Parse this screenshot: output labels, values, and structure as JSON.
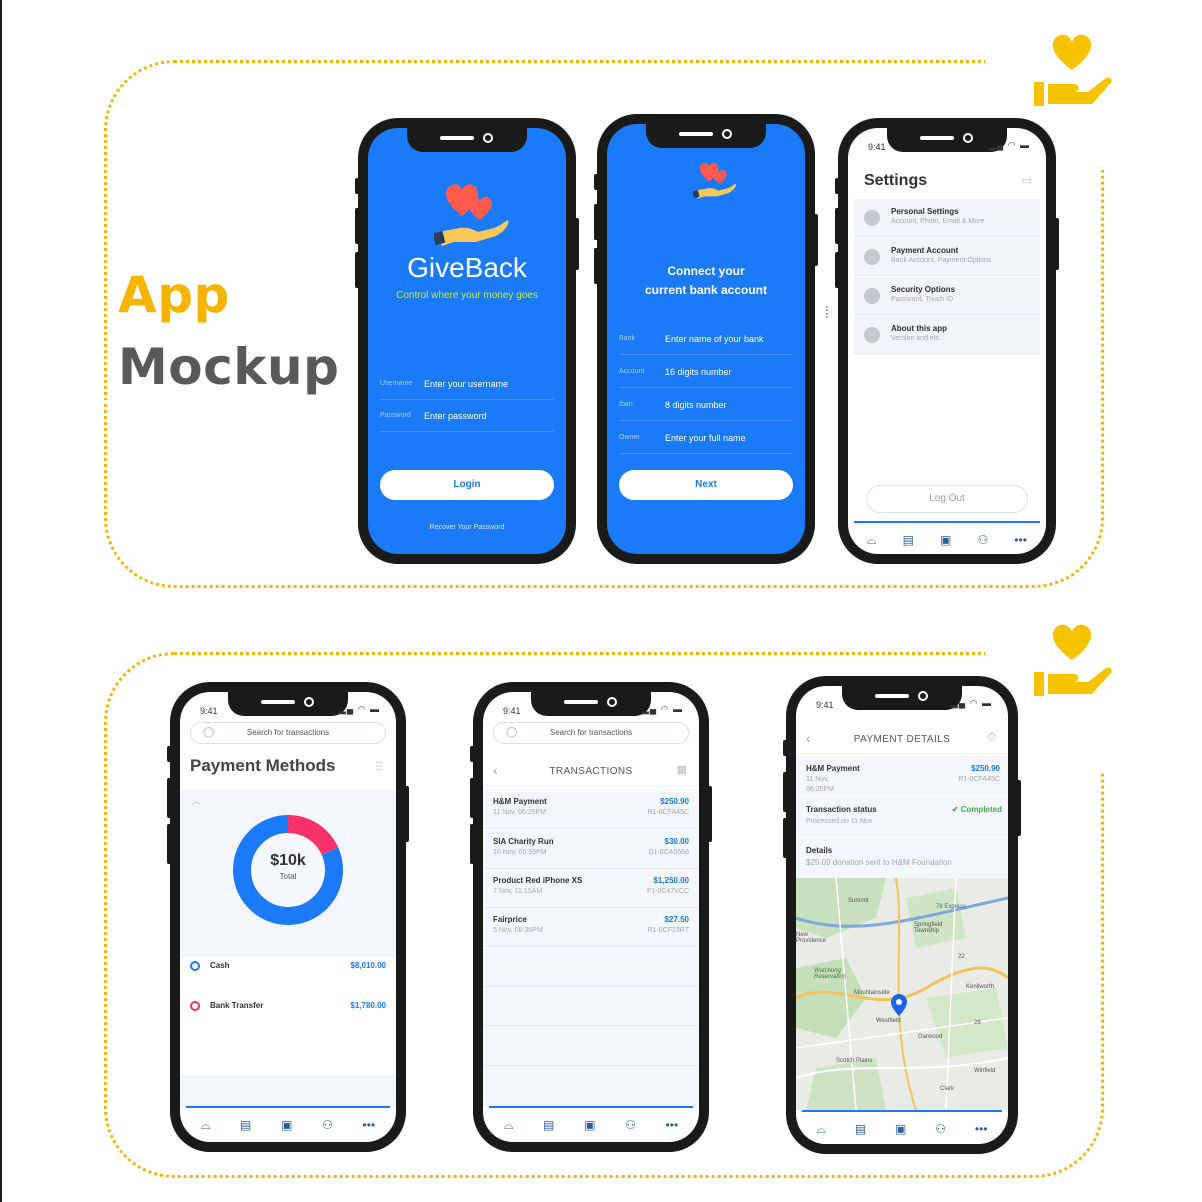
{
  "heading": {
    "line1": "App",
    "line2": "Mockup"
  },
  "colors": {
    "brand_blue": "#1b7af7",
    "accent_yellow": "#f5b400",
    "heart": "#ff5b4e",
    "success": "#3fae49"
  },
  "status_bar": {
    "time": "9:41"
  },
  "login": {
    "app_name": "GiveBack",
    "tagline": "Control where your money goes",
    "username_label": "Username",
    "username_placeholder": "Enter your username",
    "password_label": "Password",
    "password_placeholder": "Enter password",
    "login_button": "Login",
    "recover_link": "Recover Your Password"
  },
  "connect": {
    "title_line1": "Connect your",
    "title_line2": "current bank account",
    "fields": [
      {
        "label": "Bank",
        "placeholder": "Enter name of your bank"
      },
      {
        "label": "Account",
        "placeholder": "16 digits number"
      },
      {
        "label": "Iban",
        "placeholder": "8 digits number"
      },
      {
        "label": "Owner",
        "placeholder": "Enter your full name"
      }
    ],
    "next_button": "Next"
  },
  "settings": {
    "title": "Settings",
    "items": [
      {
        "title": "Personal Settings",
        "subtitle": "Account, Photo, Email & More"
      },
      {
        "title": "Payment Account",
        "subtitle": "Bank Account, Payment Options"
      },
      {
        "title": "Security Options",
        "subtitle": "Password, Touch ID"
      },
      {
        "title": "About this app",
        "subtitle": "Version and etc."
      }
    ],
    "logout_button": "Log Out"
  },
  "tabbar": {
    "icons": [
      "dashboard-icon",
      "document-icon",
      "wallet-icon",
      "users-icon",
      "more-icon"
    ]
  },
  "search": {
    "placeholder": "Search for transactions"
  },
  "payment_methods": {
    "title": "Payment Methods",
    "total_value": "$10k",
    "total_label": "Total",
    "methods": [
      {
        "name": "Cash",
        "amount": "$8,010.00",
        "color": "#1b7af7",
        "share": 0.818
      },
      {
        "name": "Bank Transfer",
        "amount": "$1,780.00",
        "color": "#f5326a",
        "share": 0.182
      }
    ]
  },
  "transactions": {
    "title": "TRANSACTIONS",
    "rows": [
      {
        "name": "H&M Payment",
        "date": "11 Nov, 06:25PM",
        "amount": "$250.90",
        "ref": "R1-0CFA45C"
      },
      {
        "name": "SIA Charity Run",
        "date": "10 Nov, 05:55PM",
        "amount": "$30.00",
        "ref": "D1-0CA5568"
      },
      {
        "name": "Product Red iPhone XS",
        "date": "7 Nov, 11:15AM",
        "amount": "$1,250.00",
        "ref": "F1-0C47VCC"
      },
      {
        "name": "Fairprice",
        "date": "5 Nov, 08:36PM",
        "amount": "$27.50",
        "ref": "R1-0CF23RT"
      }
    ]
  },
  "payment_details": {
    "title": "PAYMENT DETAILS",
    "name": "H&M Payment",
    "date": "11 Nov,",
    "time": "06:25PM",
    "amount": "$250.90",
    "ref": "R1-0CFA45C",
    "status_label": "Transaction status",
    "status_value": "Completed",
    "processed": "Processed on 11 Nov",
    "details_label": "Details",
    "details_text": "$25.09 donation sent to H&M Foundation",
    "map_labels": [
      "Summit",
      "Springfield Township",
      "New Providence",
      "Watchung Reservation",
      "Mountainside",
      "Kenilworth",
      "Westfield",
      "Garwood",
      "Scotch Plains",
      "Winfield",
      "Clark",
      "78 Express",
      "22",
      "28"
    ]
  }
}
